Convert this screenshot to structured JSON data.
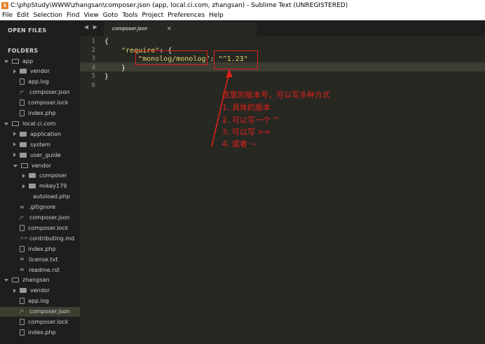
{
  "window": {
    "title": "C:\\phpStudy\\WWW\\zhangsan\\composer.json (app, local.ci.com, zhangsan) - Sublime Text (UNREGISTERED)"
  },
  "menu": [
    "File",
    "Edit",
    "Selection",
    "Find",
    "View",
    "Goto",
    "Tools",
    "Project",
    "Preferences",
    "Help"
  ],
  "sidebar": {
    "open_files_heading": "OPEN FILES",
    "folders_heading": "FOLDERS",
    "tree": [
      {
        "label": "app",
        "type": "folder-open",
        "indent": 0
      },
      {
        "label": "vendor",
        "type": "folder",
        "indent": 1
      },
      {
        "label": "app.log",
        "type": "file",
        "indent": 1
      },
      {
        "label": "composer.json",
        "type": "json",
        "indent": 1
      },
      {
        "label": "composer.lock",
        "type": "file",
        "indent": 1
      },
      {
        "label": "index.php",
        "type": "file",
        "indent": 1
      },
      {
        "label": "local.ci.com",
        "type": "folder-open",
        "indent": 0
      },
      {
        "label": "application",
        "type": "folder",
        "indent": 1
      },
      {
        "label": "system",
        "type": "folder",
        "indent": 1
      },
      {
        "label": "user_guide",
        "type": "folder",
        "indent": 1
      },
      {
        "label": "vendor",
        "type": "folder-open",
        "indent": 1
      },
      {
        "label": "composer",
        "type": "folder",
        "indent": 2
      },
      {
        "label": "mikey179",
        "type": "folder",
        "indent": 2
      },
      {
        "label": "autoload.php",
        "type": "plain",
        "indent": 2
      },
      {
        "label": ".gitignore",
        "type": "lines",
        "indent": 1
      },
      {
        "label": "composer.json",
        "type": "json",
        "indent": 1
      },
      {
        "label": "composer.lock",
        "type": "file",
        "indent": 1
      },
      {
        "label": "contributing.md",
        "type": "code",
        "indent": 1
      },
      {
        "label": "index.php",
        "type": "file",
        "indent": 1
      },
      {
        "label": "license.txt",
        "type": "lines",
        "indent": 1
      },
      {
        "label": "readme.rst",
        "type": "lines",
        "indent": 1
      },
      {
        "label": "zhangsan",
        "type": "folder-open",
        "indent": 0
      },
      {
        "label": "vendor",
        "type": "folder",
        "indent": 1
      },
      {
        "label": "app.log",
        "type": "file",
        "indent": 1
      },
      {
        "label": "composer.json",
        "type": "json",
        "indent": 1,
        "selected": true
      },
      {
        "label": "composer.lock",
        "type": "file",
        "indent": 1
      },
      {
        "label": "index.php",
        "type": "file",
        "indent": 1
      }
    ]
  },
  "tabbar": {
    "nav": "◀ ▶",
    "tab_label": "composer.json",
    "close": "×"
  },
  "editor": {
    "line_numbers": [
      "1",
      "2",
      "3",
      "4",
      "5",
      "6"
    ],
    "lines": [
      {
        "pre": "{",
        "str": "",
        "post": ""
      },
      {
        "pre": "    ",
        "str": "\"require\"",
        "post": ": {"
      },
      {
        "pre": "        ",
        "str": "\"monolog/monolog\"",
        "post": ": ",
        "str2": "\"^1.23\""
      },
      {
        "pre": "    }",
        "str": "",
        "post": ""
      },
      {
        "pre": "}",
        "str": "",
        "post": ""
      },
      {
        "pre": "",
        "str": "",
        "post": ""
      }
    ]
  },
  "annotation": {
    "lines": [
      "这里的版本号，可以写多种方式",
      "1. 具体的版本",
      "2. 可以写一个 ^",
      "3. 可以写 >=",
      "4. 或者 ~"
    ],
    "color": "#e0201b"
  }
}
